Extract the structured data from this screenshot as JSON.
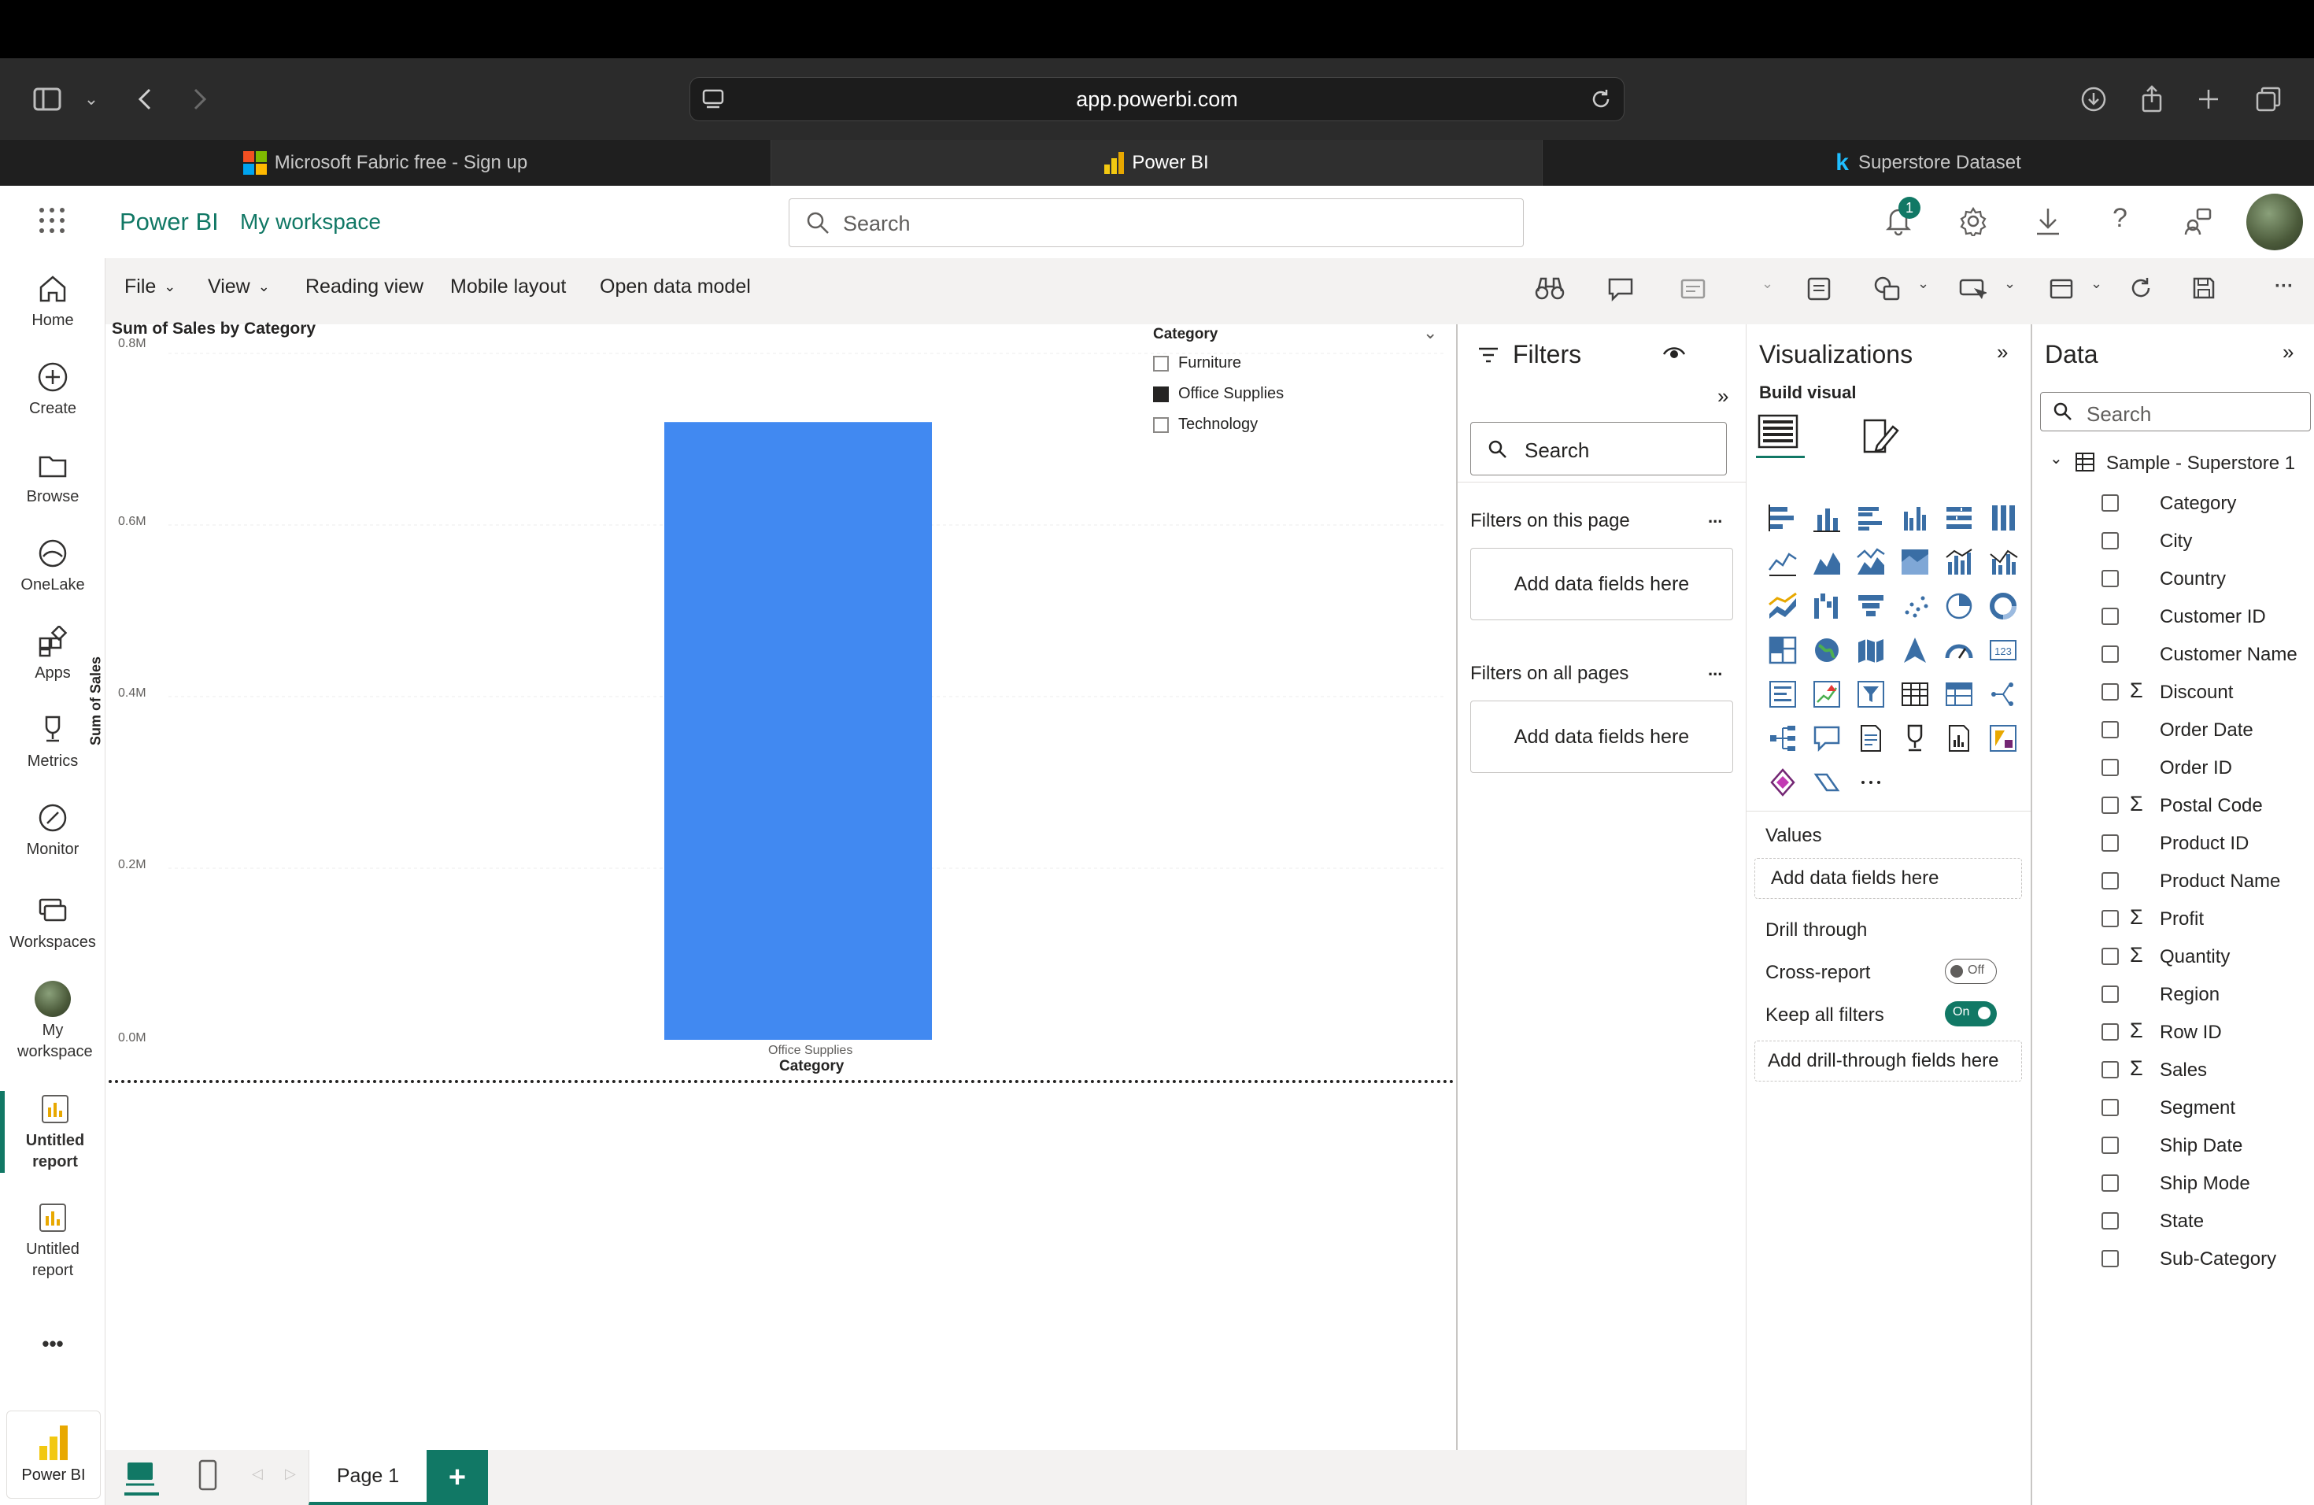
{
  "browser": {
    "url": "app.powerbi.com",
    "tabs": [
      {
        "label": "Microsoft Fabric free - Sign up"
      },
      {
        "label": "Power BI"
      },
      {
        "label": "Superstore Dataset"
      }
    ]
  },
  "header": {
    "app_name": "Power BI",
    "workspace": "My workspace",
    "search_placeholder": "Search",
    "notification_count": "1"
  },
  "leftnav": {
    "items": [
      {
        "label": "Home"
      },
      {
        "label": "Create"
      },
      {
        "label": "Browse"
      },
      {
        "label": "OneLake"
      },
      {
        "label": "Apps"
      },
      {
        "label": "Metrics"
      },
      {
        "label": "Monitor"
      },
      {
        "label": "Workspaces"
      },
      {
        "label": "My workspace"
      },
      {
        "label": "Untitled report"
      },
      {
        "label": "Untitled report"
      }
    ],
    "more": "•••",
    "bottom_label": "Power BI"
  },
  "ribbon": {
    "file": "File",
    "view": "View",
    "reading_view": "Reading view",
    "mobile_layout": "Mobile layout",
    "open_data_model": "Open data model"
  },
  "chart_data": {
    "type": "bar",
    "title": "Sum of Sales by Category",
    "xlabel": "Category",
    "ylabel": "Sum of Sales",
    "categories": [
      "Office Supplies"
    ],
    "values": [
      0.72
    ],
    "unit": "M",
    "ylim": [
      0,
      0.8
    ],
    "yticks": [
      "0.0M",
      "0.2M",
      "0.4M",
      "0.6M",
      "0.8M"
    ],
    "bar_color": "#4189f1",
    "legend": {
      "title": "Category",
      "items": [
        {
          "label": "Furniture",
          "checked": false
        },
        {
          "label": "Office Supplies",
          "checked": true
        },
        {
          "label": "Technology",
          "checked": false
        }
      ]
    }
  },
  "filters": {
    "title": "Filters",
    "search_placeholder": "Search",
    "on_this_page": "Filters on this page",
    "on_all_pages": "Filters on all pages",
    "add_fields": "Add data fields here",
    "more": "..."
  },
  "visualizations": {
    "title": "Visualizations",
    "build_visual": "Build visual",
    "values_label": "Values",
    "values_placeholder": "Add data fields here",
    "drill_through": "Drill through",
    "cross_report": "Cross-report",
    "cross_report_state": "Off",
    "keep_all_filters": "Keep all filters",
    "keep_all_filters_state": "On",
    "drill_placeholder": "Add drill-through fields here",
    "more_visuals": "···"
  },
  "data": {
    "title": "Data",
    "search_placeholder": "Search",
    "table_name": "Sample - Superstore 1",
    "fields": [
      {
        "name": "Category",
        "sigma": false
      },
      {
        "name": "City",
        "sigma": false
      },
      {
        "name": "Country",
        "sigma": false
      },
      {
        "name": "Customer ID",
        "sigma": false
      },
      {
        "name": "Customer Name",
        "sigma": false
      },
      {
        "name": "Discount",
        "sigma": true
      },
      {
        "name": "Order Date",
        "sigma": false
      },
      {
        "name": "Order ID",
        "sigma": false
      },
      {
        "name": "Postal Code",
        "sigma": true
      },
      {
        "name": "Product ID",
        "sigma": false
      },
      {
        "name": "Product Name",
        "sigma": false
      },
      {
        "name": "Profit",
        "sigma": true
      },
      {
        "name": "Quantity",
        "sigma": true
      },
      {
        "name": "Region",
        "sigma": false
      },
      {
        "name": "Row ID",
        "sigma": true
      },
      {
        "name": "Sales",
        "sigma": true
      },
      {
        "name": "Segment",
        "sigma": false
      },
      {
        "name": "Ship Date",
        "sigma": false
      },
      {
        "name": "Ship Mode",
        "sigma": false
      },
      {
        "name": "State",
        "sigma": false
      },
      {
        "name": "Sub-Category",
        "sigma": false
      }
    ],
    "sigma_symbol": "Σ"
  },
  "pages": {
    "current": "Page 1",
    "add": "+"
  },
  "colors": {
    "brand": "#117865",
    "accent_green": "#117865",
    "bar": "#4189f1"
  }
}
